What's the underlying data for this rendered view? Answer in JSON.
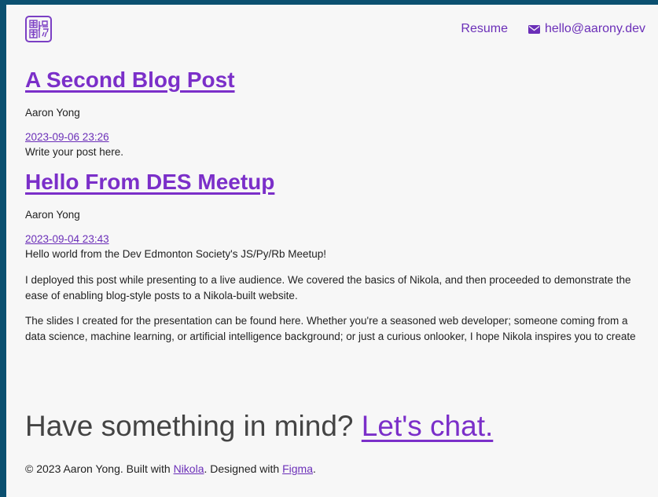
{
  "header": {
    "nav_resume": "Resume",
    "nav_email": "hello@aarony.dev",
    "logo_icon": "seal-logo-icon",
    "mail_icon": "mail-icon"
  },
  "posts": [
    {
      "title": "A Second Blog Post",
      "author": "Aaron Yong",
      "date": "2023-09-06 23:26",
      "paragraphs": [
        "Write your post here."
      ]
    },
    {
      "title": "Hello From DES Meetup",
      "author": "Aaron Yong",
      "date": "2023-09-04 23:43",
      "paragraphs": [
        "Hello world from the Dev Edmonton Society's JS/Py/Rb Meetup!",
        "I deployed this post while presenting to a live audience. We covered the basics of Nikola, and then proceeded to demonstrate the ease of enabling blog-style posts to a Nikola-built website.",
        "The slides I created for the presentation can be found here. Whether you're a seasoned web developer; someone coming from a data science, machine learning, or artificial intelligence background; or just a curious onlooker, I hope Nikola inspires you to create"
      ]
    }
  ],
  "cta": {
    "text": "Have something in mind?",
    "link": "Let's chat."
  },
  "footer": {
    "prefix": "© 2023 Aaron Yong. Built with",
    "nikola": "Nikola",
    "middle": ". Designed with",
    "figma": "Figma",
    "suffix": "."
  },
  "colors": {
    "accent": "#7b2fc9",
    "frame": "#0b5070",
    "background": "#f7f7f7"
  }
}
